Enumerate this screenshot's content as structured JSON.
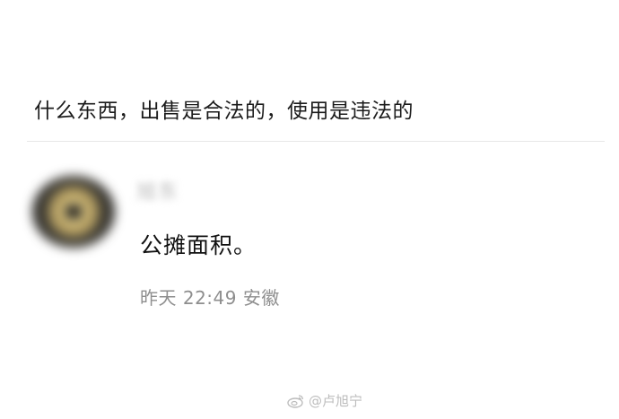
{
  "post": {
    "text": "什么东西，出售是合法的，使用是违法的"
  },
  "comment": {
    "username": "旭东",
    "text": "公摊面积。",
    "time": "昨天 22:49",
    "location": "安徽"
  },
  "watermark": {
    "handle": "@卢旭宁"
  },
  "icons": {
    "watermark_icon": "weibo-icon"
  },
  "colors": {
    "divider": "#e7e7e7",
    "meta": "#8e8e8e",
    "watermark": "#bdbdbd"
  }
}
